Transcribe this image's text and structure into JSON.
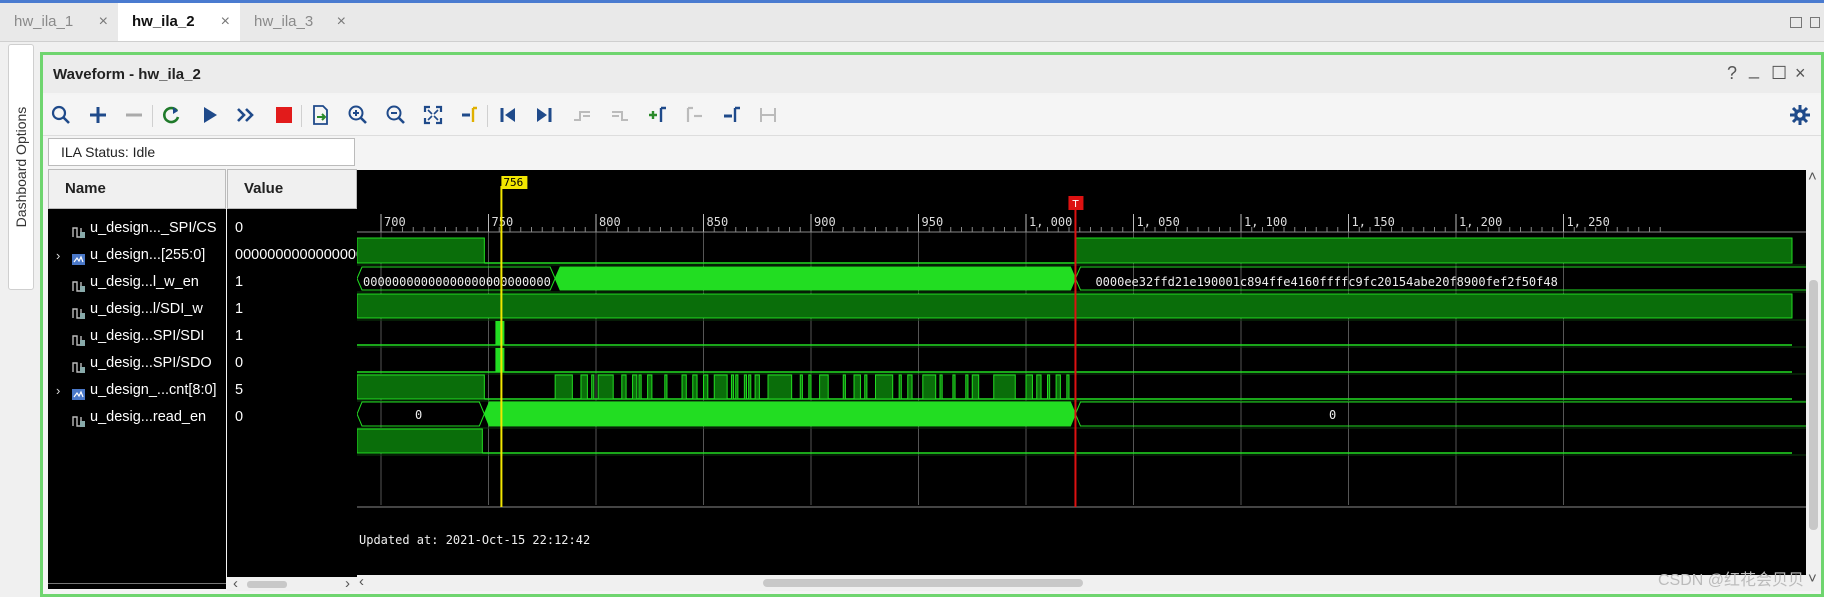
{
  "tabs": [
    {
      "label": "hw_ila_1",
      "close": "×"
    },
    {
      "label": "hw_ila_2",
      "close": "×"
    },
    {
      "label": "hw_ila_3",
      "close": "×"
    }
  ],
  "sidebar": {
    "label": "Dashboard Options"
  },
  "panel": {
    "title": "Waveform - hw_ila_2",
    "controls": {
      "help": "?",
      "minimize": "_",
      "restore": "☐",
      "close": "×"
    }
  },
  "toolbar": {
    "icons": [
      "search-icon",
      "add-icon",
      "remove-icon",
      "refresh-icon",
      "run-trigger-icon",
      "run-immediate-icon",
      "stop-icon",
      "export-icon",
      "zoom-in-icon",
      "zoom-out-icon",
      "zoom-fit-icon",
      "go-to-cursor-icon",
      "go-to-start-icon",
      "go-to-end-icon",
      "previous-transition-icon",
      "next-transition-icon",
      "add-marker-icon",
      "previous-marker-icon",
      "next-marker-icon",
      "swap-cursor-icon"
    ],
    "settings_icon": "gear-icon"
  },
  "ila_status": "ILA Status:  Idle",
  "columns": {
    "name": "Name",
    "value": "Value"
  },
  "signals": [
    {
      "name": "u_design..._SPI/CS",
      "value": "0",
      "bus": false
    },
    {
      "name": "u_design...[255:0]",
      "value": "0000000000000000",
      "bus": true
    },
    {
      "name": "u_desig...l_w_en",
      "value": "1",
      "bus": false
    },
    {
      "name": "u_desig...l/SDI_w",
      "value": "1",
      "bus": false
    },
    {
      "name": "u_desig...SPI/SDI",
      "value": "1",
      "bus": false
    },
    {
      "name": "u_desig...SPI/SDO",
      "value": "0",
      "bus": false
    },
    {
      "name": "u_design_...cnt[8:0]",
      "value": "5",
      "bus": true
    },
    {
      "name": "u_desig...read_en",
      "value": "0",
      "bus": false
    }
  ],
  "expander": "›",
  "waveform": {
    "ticks": [
      "700",
      "750",
      "800",
      "850",
      "900",
      "950",
      "1, 000",
      "1, 050",
      "1, 100",
      "1, 150",
      "1, 200",
      "1, 250"
    ],
    "cursor_label": "756",
    "trigger_label": "T",
    "bus_values": {
      "data_before": "00000000000000000000000000",
      "data_after": "0000ee32ffd21e190001c894ffe4160ffffc9fc20154abe20f8900fef2f50f48",
      "cnt_before": "0",
      "cnt_after": "0"
    },
    "updated": "Updated at: 2021-Oct-15 22:12:42",
    "colors": {
      "signal": "#22dd22",
      "fill": "#0a6e0a",
      "cursor": "#f2e600",
      "trigger": "#dd1111"
    }
  },
  "scroll": {
    "left": "‹",
    "right": "›",
    "up": "˄",
    "down": "˅"
  },
  "watermark": "CSDN @红花会贝贝"
}
